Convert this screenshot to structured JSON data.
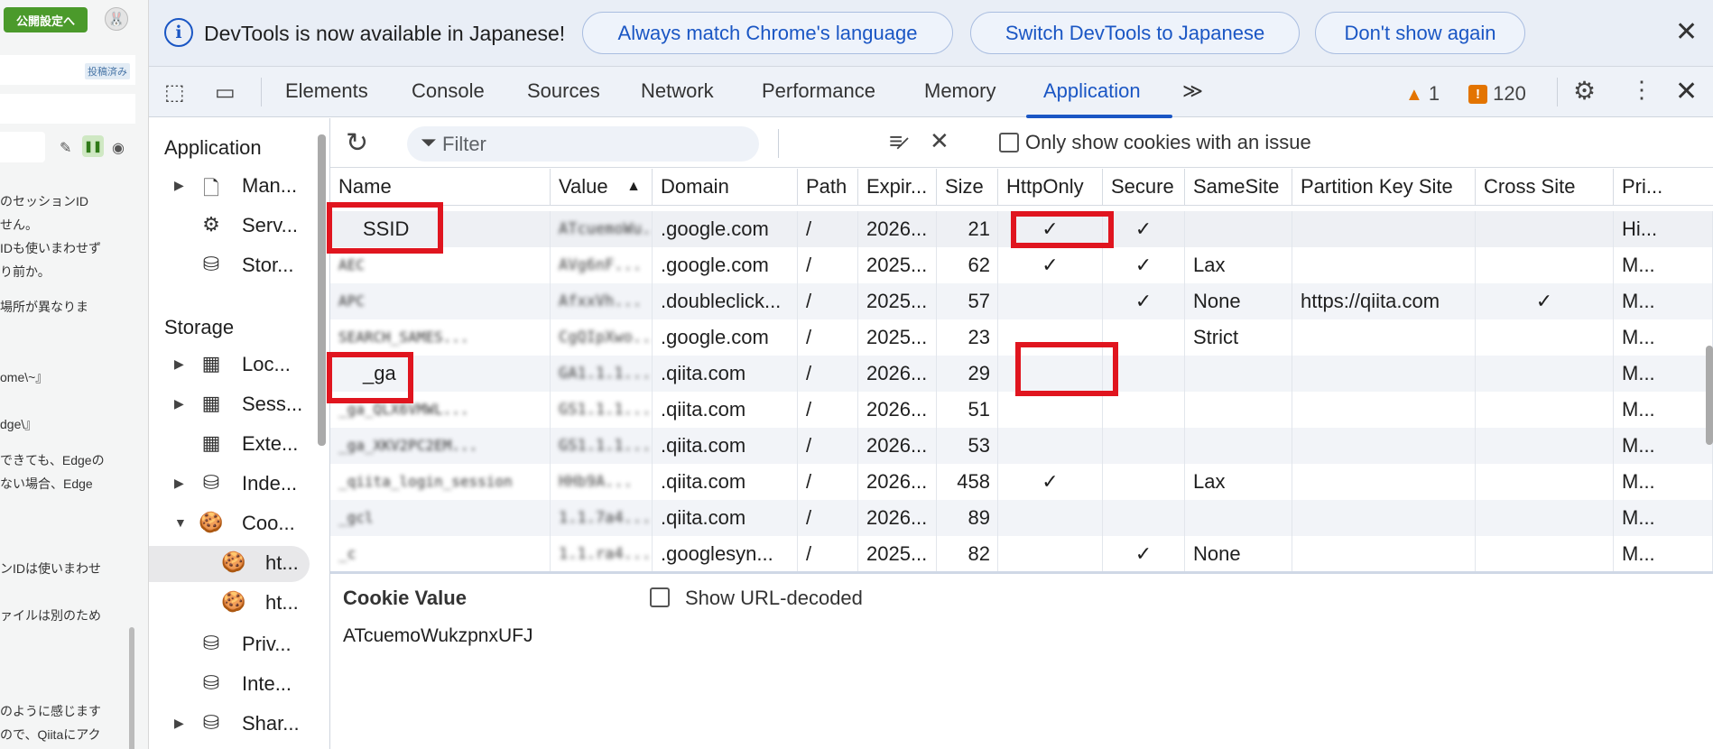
{
  "page": {
    "publish_button": "公開設定へ",
    "posted_badge": "投稿済み",
    "text_lines": [
      "のセッションID",
      "せん。",
      "IDも使いまわせず",
      "り前か。",
      "場所が異なりま",
      "ome\\~』",
      "dge\\』",
      "できても、Edgeの",
      "ない場合、Edge",
      "ンIDは使いまわせ",
      "ァイルは別のため",
      "のように感じます",
      "ので、Qiitaにアク"
    ]
  },
  "infobar": {
    "message": "DevTools is now available in Japanese!",
    "btn_match": "Always match Chrome's language",
    "btn_switch": "Switch DevTools to Japanese",
    "btn_dont": "Don't show again",
    "close": "✕"
  },
  "tabs": {
    "items": [
      "Elements",
      "Console",
      "Sources",
      "Network",
      "Performance",
      "Memory",
      "Application"
    ],
    "more": "≫",
    "warnings": "1",
    "issues": "120"
  },
  "sidebar": {
    "application_heading": "Application",
    "storage_heading": "Storage",
    "app_items": [
      "Man...",
      "Serv...",
      "Stor..."
    ],
    "storage_items": [
      "Loc...",
      "Sess...",
      "Exte...",
      "Inde...",
      "Coo...",
      "ht...",
      "ht...",
      "Priv...",
      "Inte...",
      "Shar..."
    ]
  },
  "toolbar": {
    "filter_placeholder": "Filter",
    "only_issue_label": "Only show cookies with an issue"
  },
  "table": {
    "columns": [
      "Name",
      "Value",
      "Domain",
      "Path",
      "Expir...",
      "Size",
      "HttpOnly",
      "Secure",
      "SameSite",
      "Partition Key Site",
      "Cross Site",
      "Pri..."
    ],
    "rows": [
      {
        "name": "SSID",
        "value": "ATcuemoWu...",
        "domain": ".google.com",
        "path": "/",
        "expires": "2026...",
        "size": "21",
        "httponly": "✓",
        "secure": "✓",
        "samesite": "",
        "partition": "",
        "cross": "",
        "priority": "Hi..."
      },
      {
        "name": "AEC",
        "value": "AVg6nF...",
        "domain": ".google.com",
        "path": "/",
        "expires": "2025...",
        "size": "62",
        "httponly": "✓",
        "secure": "✓",
        "samesite": "Lax",
        "partition": "",
        "cross": "",
        "priority": "M..."
      },
      {
        "name": "APC",
        "value": "AfxxVh...",
        "domain": ".doubleclick...",
        "path": "/",
        "expires": "2025...",
        "size": "57",
        "httponly": "",
        "secure": "✓",
        "samesite": "None",
        "partition": "https://qiita.com",
        "cross": "✓",
        "priority": "M..."
      },
      {
        "name": "SEARCH_SAMES...",
        "value": "CgQIpXwo...",
        "domain": ".google.com",
        "path": "/",
        "expires": "2025...",
        "size": "23",
        "httponly": "",
        "secure": "",
        "samesite": "Strict",
        "partition": "",
        "cross": "",
        "priority": "M..."
      },
      {
        "name": "_ga",
        "value": "GA1.1.1...",
        "domain": ".qiita.com",
        "path": "/",
        "expires": "2026...",
        "size": "29",
        "httponly": "",
        "secure": "",
        "samesite": "",
        "partition": "",
        "cross": "",
        "priority": "M..."
      },
      {
        "name": "_ga_QLX6VMWL...",
        "value": "GS1.1.1...",
        "domain": ".qiita.com",
        "path": "/",
        "expires": "2026...",
        "size": "51",
        "httponly": "",
        "secure": "",
        "samesite": "",
        "partition": "",
        "cross": "",
        "priority": "M..."
      },
      {
        "name": "_ga_XKV2PC2EM...",
        "value": "GS1.1.1...",
        "domain": ".qiita.com",
        "path": "/",
        "expires": "2026...",
        "size": "53",
        "httponly": "",
        "secure": "",
        "samesite": "",
        "partition": "",
        "cross": "",
        "priority": "M..."
      },
      {
        "name": "_qiita_login_session",
        "value": "HHb9A...",
        "domain": ".qiita.com",
        "path": "/",
        "expires": "2026...",
        "size": "458",
        "httponly": "✓",
        "secure": "",
        "samesite": "Lax",
        "partition": "",
        "cross": "",
        "priority": "M..."
      },
      {
        "name": "_gcl",
        "value": "1.1.7a4...",
        "domain": ".qiita.com",
        "path": "/",
        "expires": "2026...",
        "size": "89",
        "httponly": "",
        "secure": "",
        "samesite": "",
        "partition": "",
        "cross": "",
        "priority": "M..."
      },
      {
        "name": "_c",
        "value": "1.1.ra4...",
        "domain": ".googlesyn...",
        "path": "/",
        "expires": "2025...",
        "size": "82",
        "httponly": "",
        "secure": "✓",
        "samesite": "None",
        "partition": "",
        "cross": "",
        "priority": "M..."
      }
    ]
  },
  "cookie_value": {
    "title": "Cookie Value",
    "decode_label": "Show URL-decoded",
    "value": "ATcuemoWukzpnxUFJ"
  },
  "colors": {
    "accent": "#1a56c4",
    "highlight": "#e0151f",
    "warn": "#e37400"
  }
}
